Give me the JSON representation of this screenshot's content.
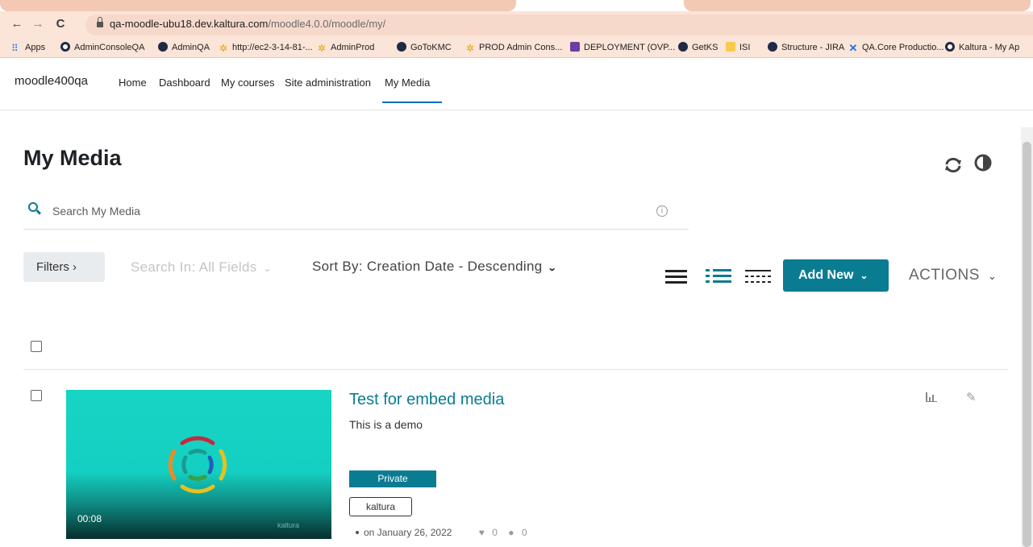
{
  "browser": {
    "nav_icons": {
      "back": "←",
      "forward": "→",
      "reload": "C"
    },
    "url_host": "qa-moodle-ubu18.dev.kaltura.com",
    "url_path": "/moodle4.0.0/moodle/my/",
    "bookmarks": [
      {
        "label": "Apps",
        "icon": "apps-grid-icon"
      },
      {
        "label": "AdminConsoleQA",
        "icon": "ring-icon"
      },
      {
        "label": "AdminQA",
        "icon": "globe-icon"
      },
      {
        "label": "http://ec2-3-14-81-...",
        "icon": "kaltura-flower-icon"
      },
      {
        "label": "AdminProd",
        "icon": "kaltura-flower-icon"
      },
      {
        "label": "GoToKMC",
        "icon": "globe-icon"
      },
      {
        "label": "PROD Admin Cons...",
        "icon": "kaltura-flower-icon"
      },
      {
        "label": "DEPLOYMENT (OVP...",
        "icon": "deployment-icon"
      },
      {
        "label": "GetKS",
        "icon": "globe-icon"
      },
      {
        "label": "ISI",
        "icon": "folder-icon"
      },
      {
        "label": "Structure - JIRA",
        "icon": "globe-icon"
      },
      {
        "label": "QA.Core Productio...",
        "icon": "confluence-x-icon"
      },
      {
        "label": "Kaltura - My Ap",
        "icon": "ring-icon"
      }
    ]
  },
  "moodle_nav": {
    "brand": "moodle400qa",
    "links": [
      "Home",
      "Dashboard",
      "My courses",
      "Site administration",
      "My Media"
    ],
    "active": "My Media"
  },
  "page": {
    "title": "My Media",
    "search_placeholder": "Search My Media",
    "filters_label": "Filters ›",
    "search_in_label": "Search In: All Fields",
    "sort_by_label": "Sort By: Creation Date - Descending",
    "add_new_label": "Add New",
    "actions_label": "ACTIONS",
    "accent_color": "#0a7c92"
  },
  "media_items": [
    {
      "title": "Test for embed media",
      "description": "This is a demo",
      "duration": "00:08",
      "watermark": "kaltura",
      "status": "Private",
      "tag": "kaltura",
      "date": "on January 26, 2022",
      "likes": "0",
      "comments": "0"
    }
  ]
}
